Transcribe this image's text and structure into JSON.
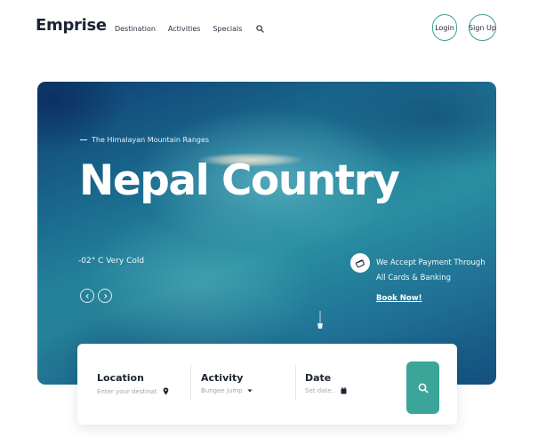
{
  "header": {
    "brand": "Emprise",
    "nav": [
      {
        "label": "Destination"
      },
      {
        "label": "Activities"
      },
      {
        "label": "Specials"
      }
    ],
    "search_icon": "search-icon",
    "login_label": "Login",
    "signup_label": "Sign Up"
  },
  "hero": {
    "subtitle": "The Himalayan Mountain Ranges",
    "title": "Nepal Country",
    "weather": "-02° C  Very Cold",
    "payment_line1": "We Accept Payment Through",
    "payment_line2": "All Cards & Banking",
    "book_now": "Book Now!"
  },
  "search_panel": {
    "location": {
      "label": "Location",
      "placeholder": "Enter your destination..."
    },
    "activity": {
      "label": "Activity",
      "placeholder": "Bungee jump..."
    },
    "date": {
      "label": "Date",
      "placeholder": "Set date..."
    }
  },
  "colors": {
    "accent": "#3aa598",
    "highlight": "#f2c84b",
    "text_dark": "#1b2433"
  }
}
